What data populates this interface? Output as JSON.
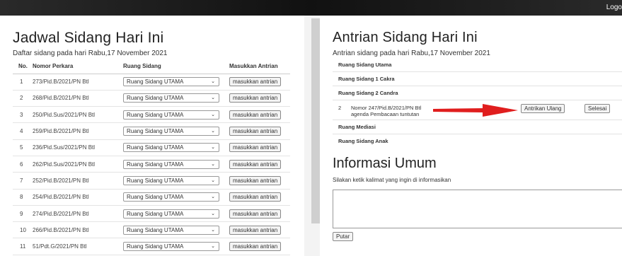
{
  "header": {
    "logout_label": "Logo"
  },
  "schedule": {
    "title": "Jadwal Sidang Hari Ini",
    "subtitle": "Daftar sidang pada hari Rabu,17 November 2021",
    "columns": {
      "no": "No.",
      "case": "Nomor Perkara",
      "room": "Ruang Sidang",
      "action": "Masukkan Antrian"
    },
    "rows": [
      {
        "no": "1",
        "case": "273/Pid.B/2021/PN Btl",
        "room": "Ruang Sidang UTAMA",
        "action": "masukkan antrian"
      },
      {
        "no": "2",
        "case": "268/Pid.B/2021/PN Btl",
        "room": "Ruang Sidang UTAMA",
        "action": "masukkan antrian"
      },
      {
        "no": "3",
        "case": "250/Pid.Sus/2021/PN Btl",
        "room": "Ruang Sidang UTAMA",
        "action": "masukkan antrian"
      },
      {
        "no": "4",
        "case": "259/Pid.B/2021/PN Btl",
        "room": "Ruang Sidang UTAMA",
        "action": "masukkan antrian"
      },
      {
        "no": "5",
        "case": "236/Pid.Sus/2021/PN Btl",
        "room": "Ruang Sidang UTAMA",
        "action": "masukkan antrian"
      },
      {
        "no": "6",
        "case": "262/Pid.Sus/2021/PN Btl",
        "room": "Ruang Sidang UTAMA",
        "action": "masukkan antrian"
      },
      {
        "no": "7",
        "case": "252/Pid.B/2021/PN Btl",
        "room": "Ruang Sidang UTAMA",
        "action": "masukkan antrian"
      },
      {
        "no": "8",
        "case": "254/Pid.B/2021/PN Btl",
        "room": "Ruang Sidang UTAMA",
        "action": "masukkan antrian"
      },
      {
        "no": "9",
        "case": "274/Pid.B/2021/PN Btl",
        "room": "Ruang Sidang UTAMA",
        "action": "masukkan antrian"
      },
      {
        "no": "10",
        "case": "266/Pid.B/2021/PN Btl",
        "room": "Ruang Sidang UTAMA",
        "action": "masukkan antrian"
      },
      {
        "no": "11",
        "case": "51/Pdt.G/2021/PN Btl",
        "room": "Ruang Sidang UTAMA",
        "action": "masukkan antrian"
      }
    ]
  },
  "queue": {
    "title": "Antrian Sidang Hari Ini",
    "subtitle": "Antrian sidang pada hari Rabu,17 November 2021",
    "rooms": {
      "utama": "Ruang Sidang Utama",
      "cakra": "Ruang Sidang 1 Cakra",
      "candra": "Ruang Sidang 2 Candra",
      "mediasi": "Ruang Mediasi",
      "anak": "Ruang Sidang Anak"
    },
    "item": {
      "no": "2",
      "line1": "Nomor 247/Pid.B/2021/PN Btl",
      "line2": "agenda Pembacaan tuntutan",
      "requeue_label": "Antrikan Ulang",
      "done_label": "Selesai"
    },
    "arrow_color": "#e01e1e"
  },
  "info": {
    "title": "Informasi Umum",
    "subtitle": "Silakan ketik kalimat yang ingin di informasikan",
    "input_value": "",
    "play_label": "Putar"
  }
}
